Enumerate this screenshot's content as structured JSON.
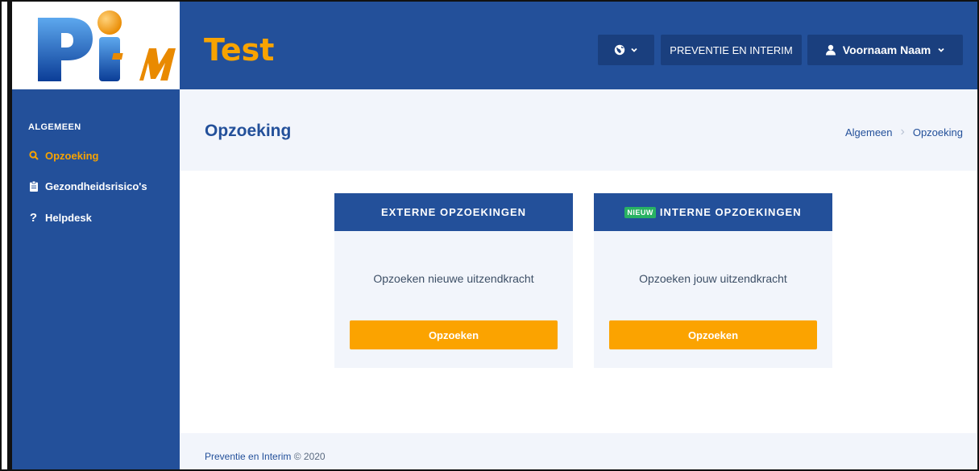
{
  "brand": {
    "logo_text_1": "Pi",
    "logo_text_2": "-M",
    "app_title": "Test"
  },
  "header": {
    "language_icon": "globe-icon",
    "organisation_label": "PREVENTIE EN INTERIM",
    "user_name": "Voornaam Naam"
  },
  "sidebar": {
    "section_label": "ALGEMEEN",
    "items": [
      {
        "label": "Opzoeking",
        "icon": "search-icon",
        "active": true
      },
      {
        "label": "Gezondheidsrisico's",
        "icon": "clipboard-icon",
        "active": false
      },
      {
        "label": "Helpdesk",
        "icon": "question-icon",
        "active": false
      }
    ]
  },
  "page": {
    "title": "Opzoeking",
    "breadcrumb": [
      "Algemeen",
      "Opzoeking"
    ]
  },
  "cards": [
    {
      "header": "EXTERNE OPZOEKINGEN",
      "text": "Opzoeken nieuwe uitzendkracht",
      "button": "Opzoeken"
    },
    {
      "badge": "NIEUW",
      "header": "INTERNE OPZOEKINGEN",
      "text": "Opzoeken jouw uitzendkracht",
      "button": "Opzoeken"
    }
  ],
  "footer": {
    "org": "Preventie en Interim",
    "copyright": "© 2020"
  },
  "colors": {
    "primary": "#23509a",
    "accent": "#f7a300",
    "badge": "#28b263",
    "light": "#f2f5fb"
  }
}
